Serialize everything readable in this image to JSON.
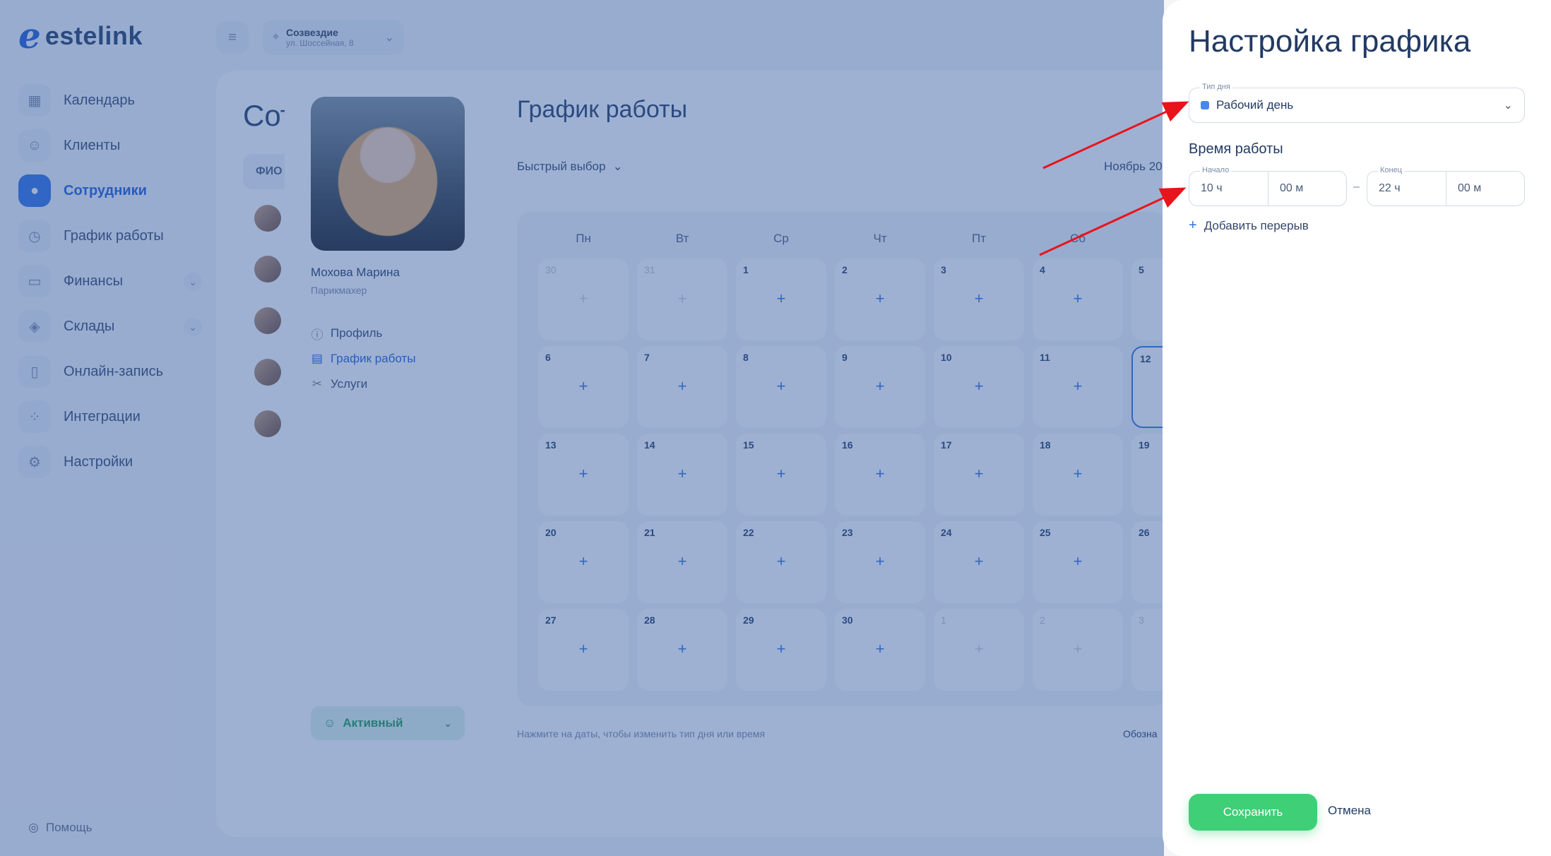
{
  "app": {
    "brand": "estelink"
  },
  "sidebar": {
    "items": [
      {
        "label": "Календарь",
        "icon": "calendar-icon"
      },
      {
        "label": "Клиенты",
        "icon": "clients-icon"
      },
      {
        "label": "Сотрудники",
        "icon": "user-icon",
        "active": true
      },
      {
        "label": "График работы",
        "icon": "clock-icon"
      },
      {
        "label": "Финансы",
        "icon": "wallet-icon",
        "expandable": true
      },
      {
        "label": "Склады",
        "icon": "boxes-icon",
        "expandable": true
      },
      {
        "label": "Онлайн-запись",
        "icon": "phone-icon"
      },
      {
        "label": "Интеграции",
        "icon": "grid-icon"
      },
      {
        "label": "Настройки",
        "icon": "gear-icon"
      }
    ],
    "help": "Помощь"
  },
  "topbar": {
    "location_name": "Созвездие",
    "location_address": "ул. Шоссейная, 8"
  },
  "page": {
    "title": "Сотрудники",
    "col_header": "ФИО"
  },
  "profile": {
    "name": "Мохова Марина",
    "role": "Парикмахер",
    "menu": [
      {
        "label": "Профиль",
        "icon": "info-icon"
      },
      {
        "label": "График работы",
        "icon": "calendar-icon",
        "active": true
      },
      {
        "label": "Услуги",
        "icon": "scissors-icon"
      }
    ],
    "status": "Активный"
  },
  "schedule": {
    "title": "График работы",
    "quick_select": "Быстрый выбор",
    "month": "Ноябрь 20",
    "weekdays": [
      "Пн",
      "Вт",
      "Ср",
      "Чт",
      "Пт",
      "Сб"
    ],
    "weeks": [
      [
        "30",
        "31",
        "1",
        "2",
        "3",
        "4",
        "5"
      ],
      [
        "6",
        "7",
        "8",
        "9",
        "10",
        "11",
        "12"
      ],
      [
        "13",
        "14",
        "15",
        "16",
        "17",
        "18",
        "19"
      ],
      [
        "20",
        "21",
        "22",
        "23",
        "24",
        "25",
        "26"
      ],
      [
        "27",
        "28",
        "29",
        "30",
        "1",
        "2",
        "3"
      ]
    ],
    "hint": "Нажмите на даты, чтобы изменить тип дня или время",
    "legend": "Обозна"
  },
  "panel": {
    "title": "Настройка графика",
    "day_type_label": "Тип дня",
    "day_type_value": "Рабочий день",
    "work_time_title": "Время работы",
    "start_label": "Начало",
    "end_label": "Конец",
    "start_hours": "10 ч",
    "start_minutes": "00 м",
    "end_hours": "22 ч",
    "end_minutes": "00 м",
    "separator": "–",
    "add_break": "Добавить перерыв",
    "save": "Сохранить",
    "cancel": "Отмена"
  },
  "colors": {
    "accent": "#2f6fe4",
    "save": "#3fcf77",
    "overlay": "#355ca0",
    "annotation_arrow": "#e8141b"
  }
}
